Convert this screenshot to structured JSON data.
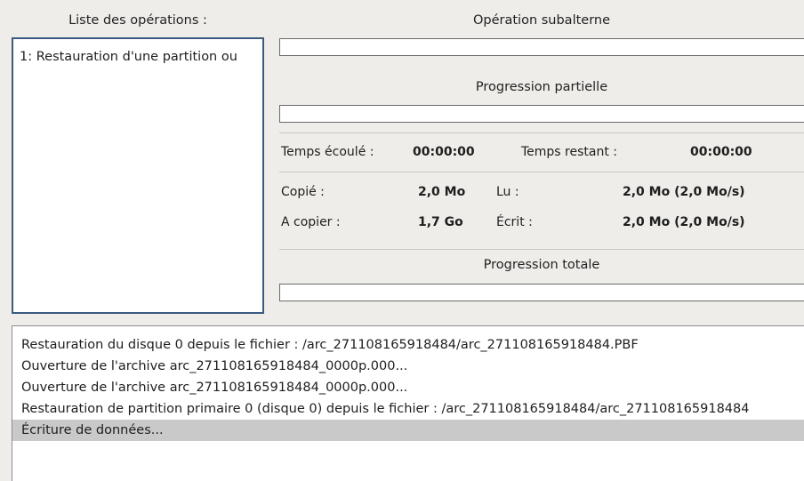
{
  "operations": {
    "header": "Liste des opérations :",
    "items": [
      {
        "label": "1: Restauration d'une partition ou"
      }
    ]
  },
  "suboperation": {
    "header": "Opération subalterne",
    "progress": 0
  },
  "partial": {
    "header": "Progression partielle",
    "progress": 0
  },
  "time": {
    "elapsed_label": "Temps écoulé :",
    "elapsed_value": "00:00:00",
    "remaining_label": "Temps restant :",
    "remaining_value": "00:00:00"
  },
  "stats": {
    "copied_label": "Copié :",
    "copied_value": "2,0 Mo",
    "to_copy_label": "A copier :",
    "to_copy_value": "1,7 Go",
    "read_label": "Lu :",
    "read_value": "2,0 Mo (2,0 Mo/s)",
    "written_label": "Écrit :",
    "written_value": "2,0 Mo (2,0 Mo/s)"
  },
  "total": {
    "header": "Progression totale",
    "progress": 0
  },
  "log": {
    "lines": [
      "Restauration du disque 0 depuis le fichier : /arc_271108165918484/arc_271108165918484.PBF",
      "Ouverture de l'archive arc_271108165918484_0000p.000...",
      "Ouverture de l'archive arc_271108165918484_0000p.000...",
      "Restauration de partition primaire 0 (disque 0) depuis le fichier : /arc_271108165918484/arc_271108165918484",
      "Écriture de données..."
    ],
    "selected_index": 4
  }
}
